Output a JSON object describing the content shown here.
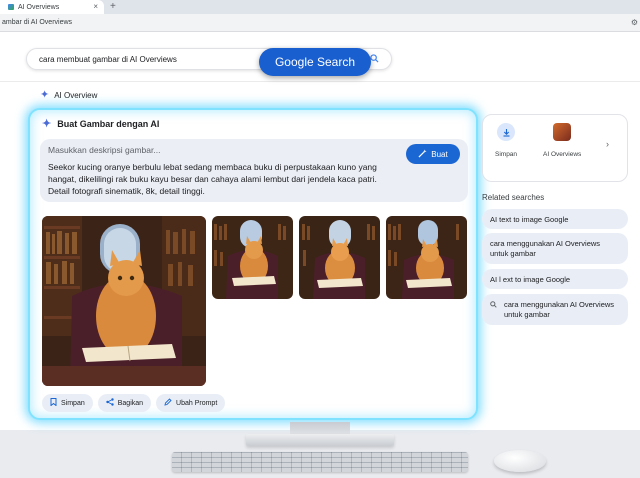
{
  "browser": {
    "tab_title": "AI Overviews",
    "tab_close": "×",
    "new_tab": "+",
    "url_text": "ambar di AI Overviews",
    "settings_icon": "⚙"
  },
  "search": {
    "query": "cara membuat gambar di AI Overviews",
    "button_label": "Google Search"
  },
  "ai_overview": {
    "label": "AI Overview",
    "panel_title": "Buat Gambar dengan AI",
    "prompt_placeholder": "Masukkan deskripsi gambar...",
    "prompt_text": "Seekor kucing oranye berbulu lebat sedang membaca buku di perpustakaan kuno yang hangat, dikelilingi rak buku kayu besar dan cahaya alami lembut dari jendela kaca patri. Detail fotografi sinematik, 8k, detail tinggi.",
    "generate_button": "Buat",
    "actions": [
      {
        "label": "Simpan",
        "icon": "bookmark-icon"
      },
      {
        "label": "Bagikan",
        "icon": "share-icon"
      },
      {
        "label": "Ubah Prompt",
        "icon": "pencil-icon"
      }
    ]
  },
  "right_card": {
    "save_label": "Simpan",
    "thumb_label": "AI Overviews",
    "arrow": "›"
  },
  "related": {
    "title": "Related searches",
    "items": [
      "AI text to image Google",
      "cara menggunakan AI Overviews untuk gambar",
      "AI l ext to image Google",
      "cara menggunakan AI Overviews untuk gambar"
    ]
  },
  "colors": {
    "google_blue": "#1a5fd0",
    "glow": "#7fe3ff",
    "chip_bg": "#e9eef6"
  }
}
